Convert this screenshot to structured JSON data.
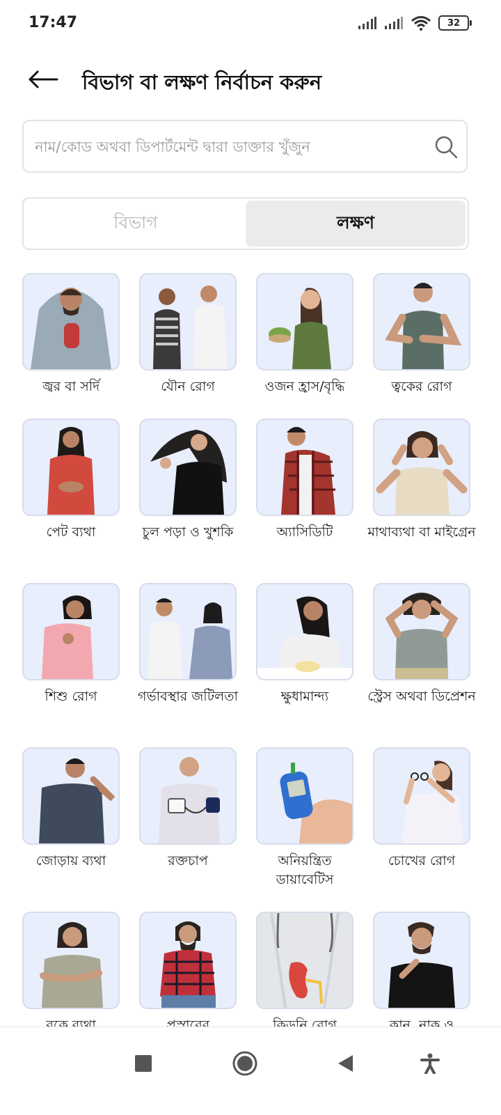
{
  "status_bar": {
    "time": "17:47",
    "battery": "32"
  },
  "header": {
    "title": "বিভাগ বা লক্ষণ নির্বাচন করুন"
  },
  "search": {
    "placeholder": "নাম/কোড অথবা ডিপার্টমেন্ট দ্বারা ডাক্তার খুঁজুন"
  },
  "tabs": [
    {
      "label": "বিভাগ",
      "active": false
    },
    {
      "label": "লক্ষণ",
      "active": true
    }
  ],
  "symptoms": [
    {
      "label": "জ্বর বা সর্দি"
    },
    {
      "label": "যৌন রোগ"
    },
    {
      "label": "ওজন হ্রাস/বৃদ্ধি"
    },
    {
      "label": "ত্বকের রোগ"
    },
    {
      "label": "পেট ব্যথা"
    },
    {
      "label": "চুল পড়া ও খুশকি"
    },
    {
      "label": "অ্যাসিডিটি"
    },
    {
      "label": "মাথাব্যথা বা মাইগ্রেন"
    },
    {
      "label": "শিশু রোগ"
    },
    {
      "label": "গর্ভাবস্থার জটিলতা"
    },
    {
      "label": "ক্ষুধামান্দ্য"
    },
    {
      "label": "স্ট্রেস অথবা ডিপ্রেশন"
    },
    {
      "label": "জোড়ায় ব্যথা"
    },
    {
      "label": "রক্তচাপ"
    },
    {
      "label": "অনিয়ন্ত্রিত ডায়াবেটিস"
    },
    {
      "label": "চোখের রোগ"
    },
    {
      "label": "বুকে ব্যথা"
    },
    {
      "label": "প্রস্রাবের"
    },
    {
      "label": "কিডনি রোগ"
    },
    {
      "label": "কান, নাক ও"
    }
  ],
  "colors": {
    "tile_bg": "#e8eefb",
    "tile_border": "#d8dcea",
    "active_tab_bg": "#ebebeb"
  },
  "nav": {
    "icons": [
      "square-icon",
      "circle-home-icon",
      "back-triangle-icon",
      "accessibility-icon"
    ]
  }
}
